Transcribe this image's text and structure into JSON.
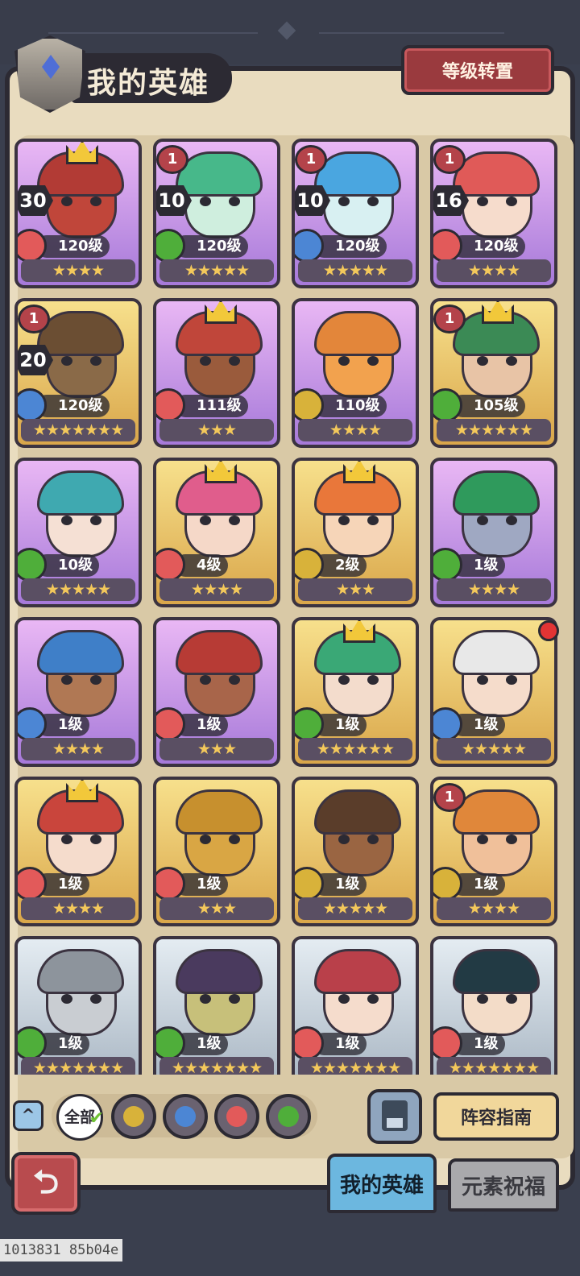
{
  "header": {
    "title": "我的英雄",
    "rank_button": "等级转置"
  },
  "heroes": [
    {
      "level": "120级",
      "element": "fire",
      "stars": "★★★★",
      "frame": "purple",
      "skin": "#c0463a",
      "hair": "#b23b35",
      "num": "30",
      "crown": true,
      "one": false
    },
    {
      "level": "120级",
      "element": "wind",
      "stars": "★★★★★",
      "frame": "purple",
      "skin": "#cfeede",
      "hair": "#47b88a",
      "num": "10",
      "crown": false,
      "one": true
    },
    {
      "level": "120级",
      "element": "water",
      "stars": "★★★★★",
      "frame": "purple",
      "skin": "#d8f0f2",
      "hair": "#4aa6e0",
      "num": "10",
      "crown": false,
      "one": true
    },
    {
      "level": "120级",
      "element": "fire",
      "stars": "★★★★",
      "frame": "purple",
      "skin": "#f6dccc",
      "hair": "#e05a58",
      "num": "16",
      "crown": false,
      "one": true
    },
    {
      "level": "120级",
      "element": "water",
      "stars": "★★★★★★★",
      "frame": "gold",
      "skin": "#8a6a48",
      "hair": "#6b4e33",
      "num": "20",
      "crown": false,
      "one": true
    },
    {
      "level": "111级",
      "element": "fire",
      "stars": "★★★",
      "frame": "purple",
      "skin": "#9a5b3c",
      "hair": "#c0463a",
      "num": "",
      "crown": true,
      "one": false
    },
    {
      "level": "110级",
      "element": "earth",
      "stars": "★★★★",
      "frame": "purple",
      "skin": "#f2a24e",
      "hair": "#e3863a",
      "num": "",
      "crown": false,
      "one": false
    },
    {
      "level": "105级",
      "element": "wind",
      "stars": "★★★★★★",
      "frame": "gold",
      "skin": "#e8c4a6",
      "hair": "#3b8a55",
      "num": "",
      "crown": true,
      "one": true
    },
    {
      "level": "10级",
      "element": "wind",
      "stars": "★★★★★",
      "frame": "purple",
      "skin": "#f5e0d4",
      "hair": "#3fa9b0",
      "num": "",
      "crown": false,
      "one": false
    },
    {
      "level": "4级",
      "element": "fire",
      "stars": "★★★★",
      "frame": "gold",
      "skin": "#f5d8c8",
      "hair": "#e05d8c",
      "num": "",
      "crown": true,
      "one": false
    },
    {
      "level": "2级",
      "element": "earth",
      "stars": "★★★",
      "frame": "gold",
      "skin": "#f6d5b8",
      "hair": "#e9773a",
      "num": "",
      "crown": true,
      "one": false
    },
    {
      "level": "1级",
      "element": "wind",
      "stars": "★★★★",
      "frame": "purple",
      "skin": "#9fa8c2",
      "hair": "#2f9a5c",
      "num": "",
      "crown": false,
      "one": false
    },
    {
      "level": "1级",
      "element": "water",
      "stars": "★★★★",
      "frame": "purple",
      "skin": "#b07854",
      "hair": "#3f7fc8",
      "num": "",
      "crown": false,
      "one": false
    },
    {
      "level": "1级",
      "element": "fire",
      "stars": "★★★",
      "frame": "purple",
      "skin": "#a8654a",
      "hair": "#b73b35",
      "num": "",
      "crown": false,
      "one": false
    },
    {
      "level": "1级",
      "element": "wind",
      "stars": "★★★★★★",
      "frame": "gold",
      "skin": "#f3dccc",
      "hair": "#3aa876",
      "num": "",
      "crown": true,
      "one": false
    },
    {
      "level": "1级",
      "element": "water",
      "stars": "★★★★★",
      "frame": "gold",
      "skin": "#f5dccb",
      "hair": "#e8e8e8",
      "num": "",
      "crown": false,
      "one": false
    },
    {
      "level": "1级",
      "element": "fire",
      "stars": "★★★★",
      "frame": "gold",
      "skin": "#f5dccc",
      "hair": "#c9453c",
      "num": "",
      "crown": true,
      "one": false
    },
    {
      "level": "1级",
      "element": "fire",
      "stars": "★★★",
      "frame": "gold",
      "skin": "#d9a644",
      "hair": "#c7902e",
      "num": "",
      "crown": false,
      "one": false
    },
    {
      "level": "1级",
      "element": "earth",
      "stars": "★★★★★",
      "frame": "gold",
      "skin": "#9a6542",
      "hair": "#5a3d2a",
      "num": "",
      "crown": false,
      "one": false
    },
    {
      "level": "1级",
      "element": "earth",
      "stars": "★★★★",
      "frame": "gold",
      "skin": "#f0c09a",
      "hair": "#e0873a",
      "num": "",
      "crown": false,
      "one": true
    },
    {
      "level": "1级",
      "element": "wind",
      "stars": "★★★★★★★",
      "frame": "silver",
      "skin": "#c9cdd2",
      "hair": "#8d949c",
      "num": "",
      "crown": false,
      "one": false
    },
    {
      "level": "1级",
      "element": "wind",
      "stars": "★★★★★★★",
      "frame": "silver",
      "skin": "#c7c07a",
      "hair": "#4a3a5e",
      "num": "",
      "crown": false,
      "one": false
    },
    {
      "level": "1级",
      "element": "fire",
      "stars": "★★★★★★★",
      "frame": "silver",
      "skin": "#f5dccc",
      "hair": "#b9404a",
      "num": "",
      "crown": false,
      "one": false
    },
    {
      "level": "1级",
      "element": "fire",
      "stars": "★★★★★★★",
      "frame": "silver",
      "skin": "#f3dcc8",
      "hair": "#223a44",
      "num": "",
      "crown": false,
      "one": false
    }
  ],
  "filters": {
    "collapse": "^",
    "all_label": "全部",
    "elements": [
      "earth",
      "water",
      "fire",
      "wind"
    ]
  },
  "guide_button": "阵容指南",
  "tabs": {
    "my_heroes": "我的英雄",
    "element_blessing": "元素祝福"
  },
  "back_icon": "⮌",
  "debug_text": "1013831 85b04e",
  "colors": {
    "fire": "#e25a5a",
    "wind": "#4fae3a",
    "water": "#4c86d4",
    "earth": "#d8b23a"
  }
}
